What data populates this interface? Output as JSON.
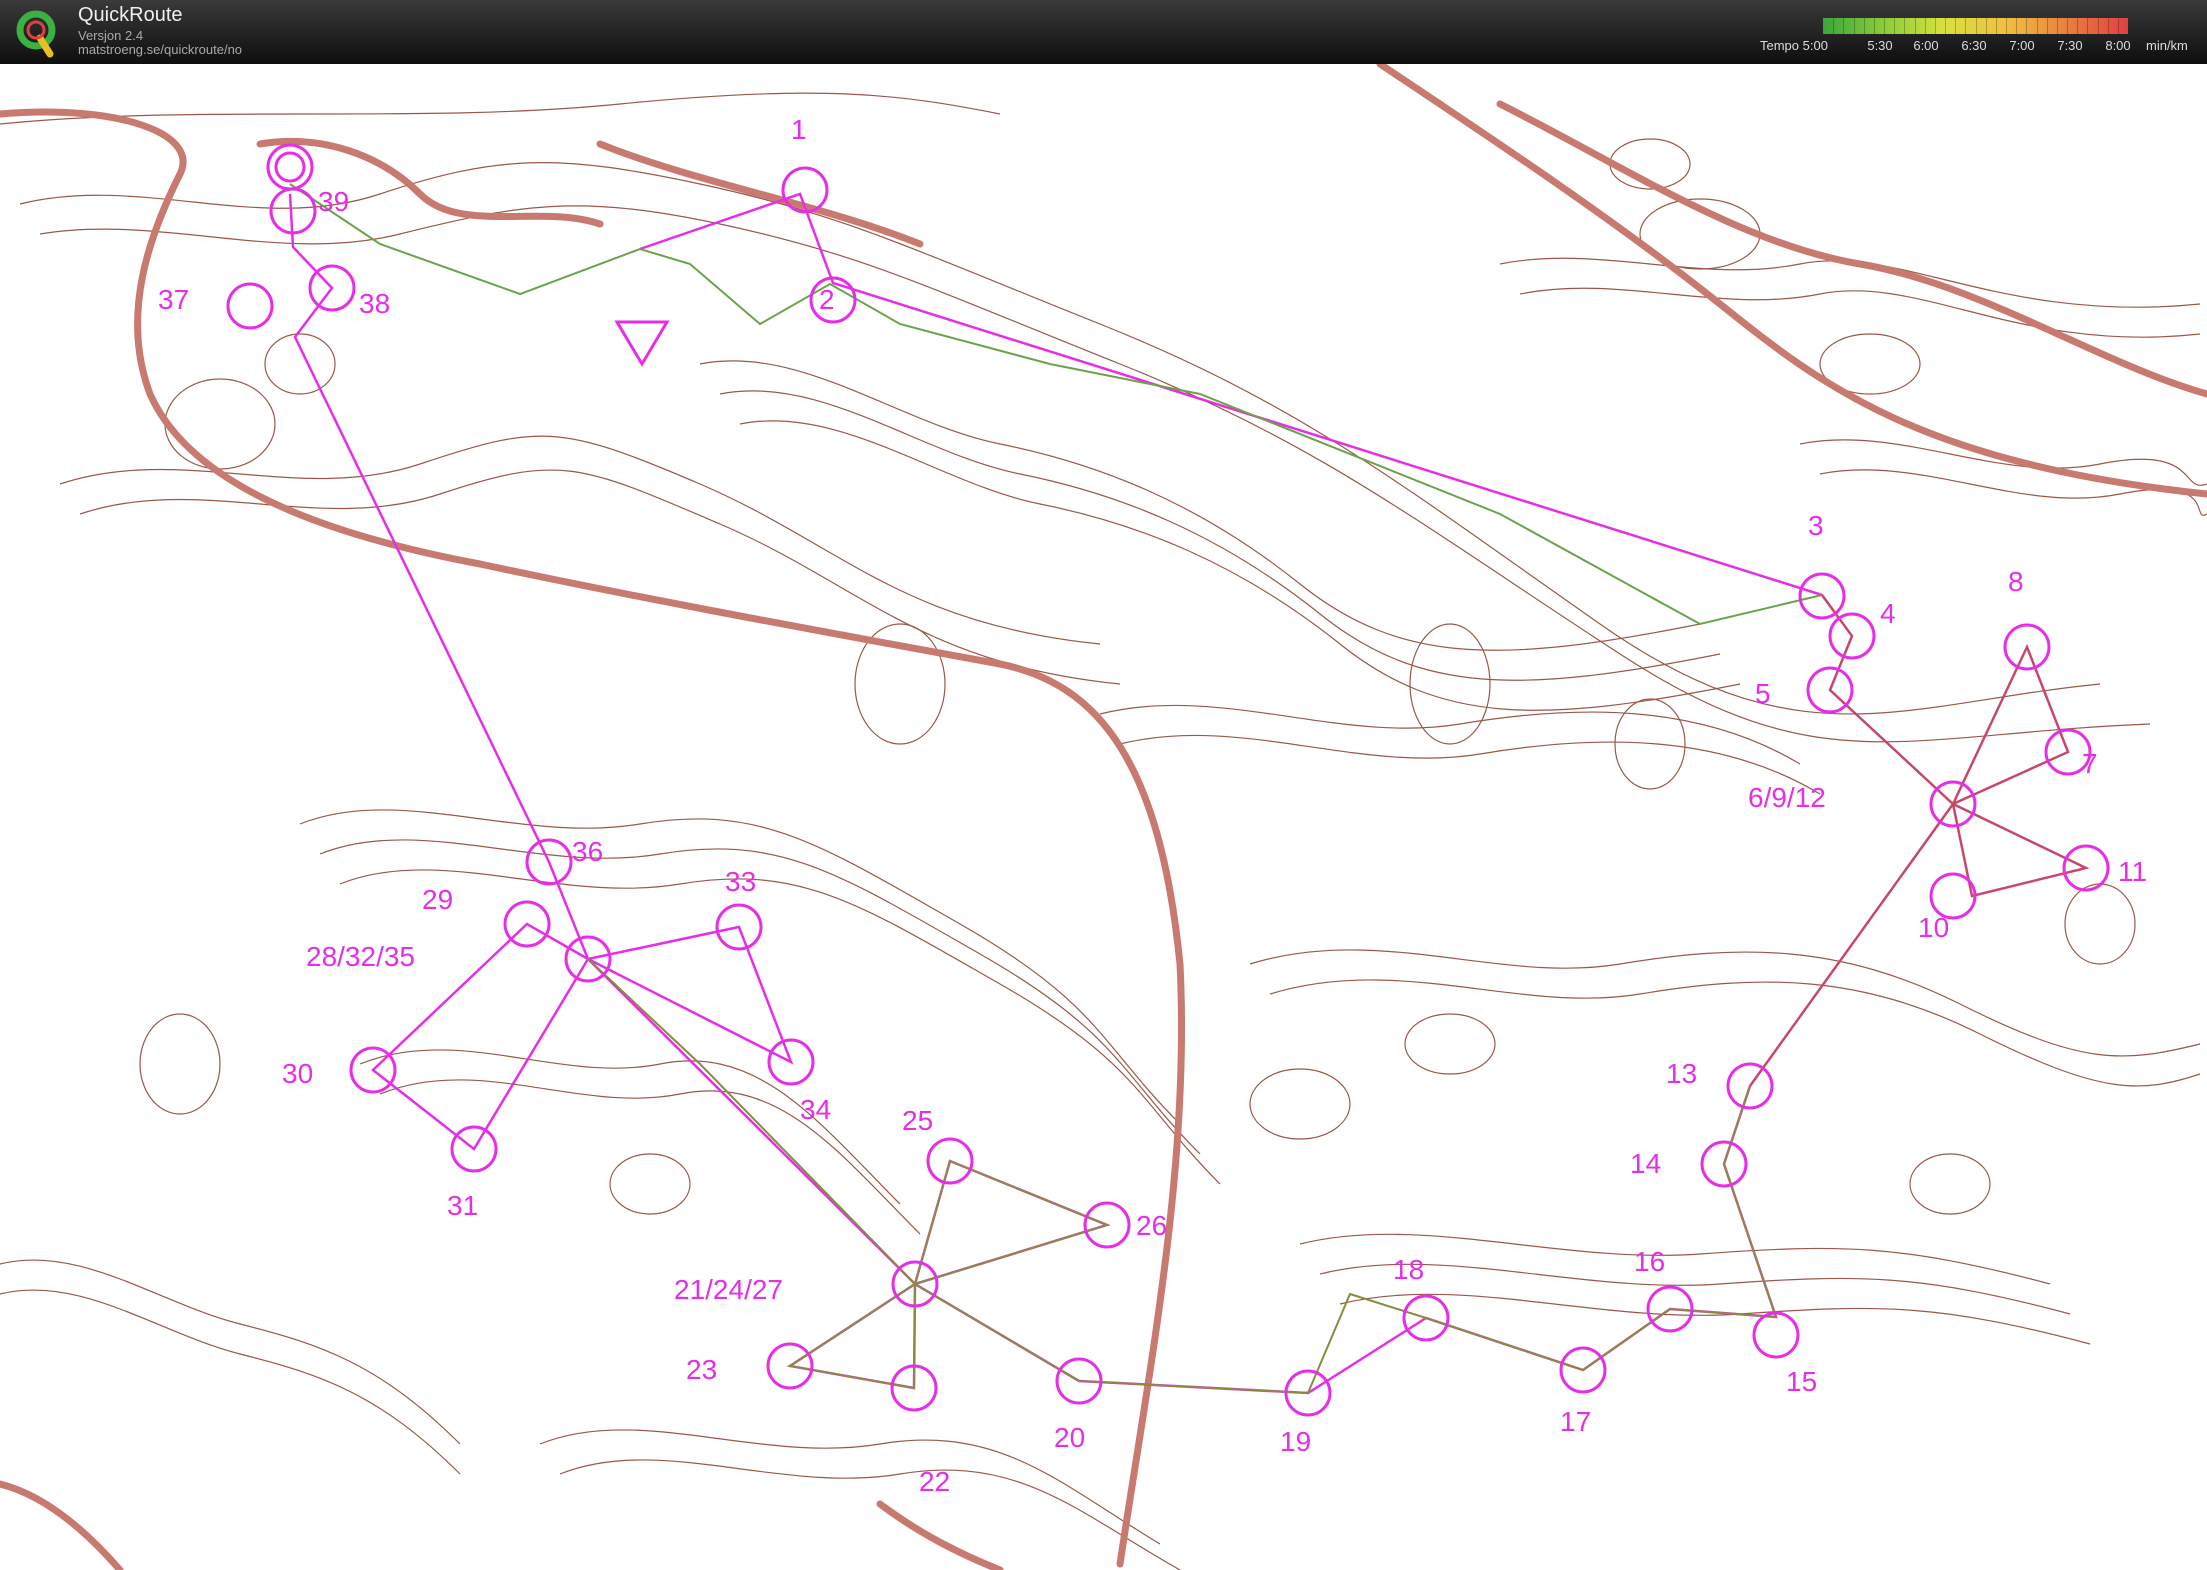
{
  "app": {
    "title": "QuickRoute",
    "version": "Versjon 2.4",
    "url": "matstroeng.se/quickroute/no"
  },
  "legend": {
    "label": "Tempo 5:00",
    "ticks": [
      "5:30",
      "6:00",
      "6:30",
      "7:00",
      "7:30",
      "8:00"
    ],
    "unit": "min/km",
    "colors": [
      "#3aa63a",
      "#8ccc3a",
      "#d8e040",
      "#f0c040",
      "#e88040",
      "#e04040"
    ]
  },
  "map": {
    "course_color": "#e62ee6",
    "contour_color": "#8a3a2a",
    "road_color": "#c87a70",
    "controls": [
      {
        "label": "1"
      },
      {
        "label": "2"
      },
      {
        "label": "3"
      },
      {
        "label": "4"
      },
      {
        "label": "5"
      },
      {
        "label": "6/9/12"
      },
      {
        "label": "7"
      },
      {
        "label": "8"
      },
      {
        "label": "10"
      },
      {
        "label": "11"
      },
      {
        "label": "13"
      },
      {
        "label": "14"
      },
      {
        "label": "15"
      },
      {
        "label": "16"
      },
      {
        "label": "17"
      },
      {
        "label": "18"
      },
      {
        "label": "19"
      },
      {
        "label": "20"
      },
      {
        "label": "21/24/27"
      },
      {
        "label": "22"
      },
      {
        "label": "23"
      },
      {
        "label": "25"
      },
      {
        "label": "26"
      },
      {
        "label": "28/32/35"
      },
      {
        "label": "29"
      },
      {
        "label": "30"
      },
      {
        "label": "31"
      },
      {
        "label": "33"
      },
      {
        "label": "34"
      },
      {
        "label": "36"
      },
      {
        "label": "37"
      },
      {
        "label": "38"
      },
      {
        "label": "39"
      }
    ]
  }
}
